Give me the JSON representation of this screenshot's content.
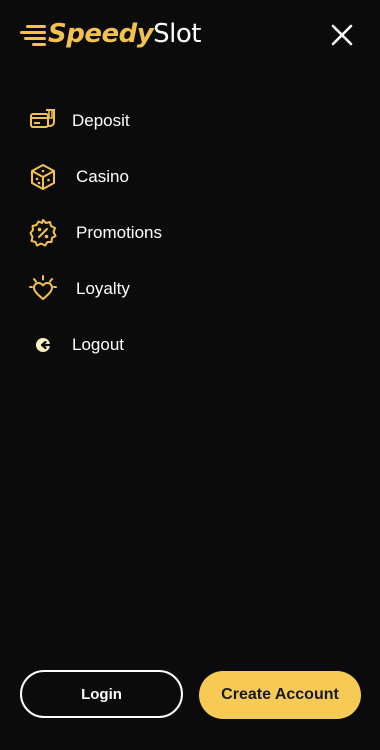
{
  "brand": {
    "name_part1": "Speedy",
    "name_part2": "Slot",
    "accent_color": "#f2c14e"
  },
  "header": {
    "close_icon": "close-icon"
  },
  "menu": {
    "items": [
      {
        "label": "Deposit",
        "icon": "deposit-card-icon"
      },
      {
        "label": "Casino",
        "icon": "dice-icon"
      },
      {
        "label": "Promotions",
        "icon": "percent-badge-icon"
      },
      {
        "label": "Loyalty",
        "icon": "heart-sparkle-icon"
      },
      {
        "label": "Logout",
        "icon": "logout-icon"
      }
    ]
  },
  "footer": {
    "login_label": "Login",
    "create_account_label": "Create Account"
  },
  "colors": {
    "background": "#0b0b0b",
    "accent": "#f2c14e",
    "primary_button": "#f7c955",
    "text": "#ffffff"
  }
}
